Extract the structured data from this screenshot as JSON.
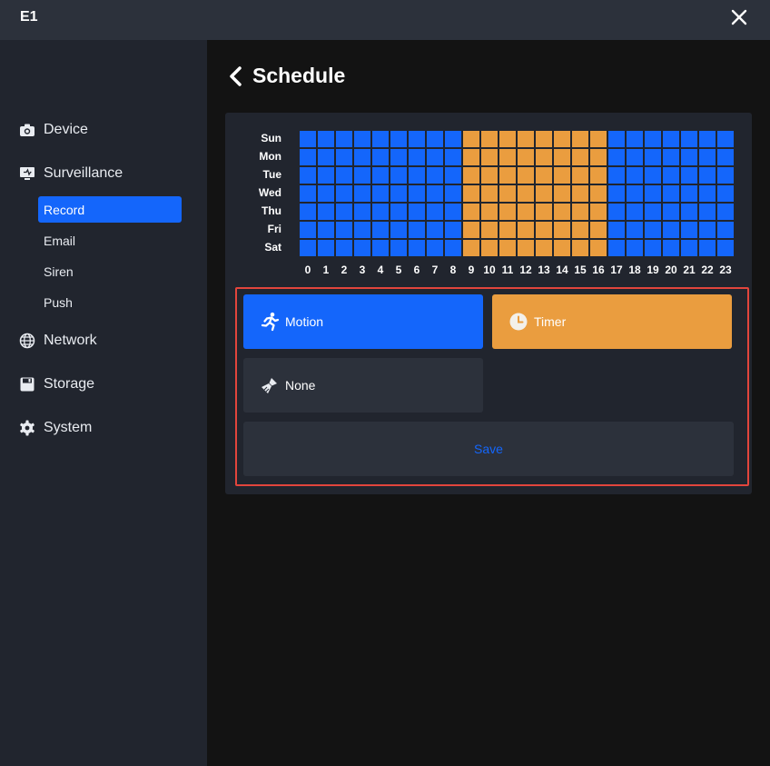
{
  "app": {
    "title": "E1"
  },
  "sidebar": {
    "items": [
      {
        "label": "Device",
        "icon": "camera-icon"
      },
      {
        "label": "Surveillance",
        "icon": "monitor-icon"
      },
      {
        "label": "Network",
        "icon": "globe-icon"
      },
      {
        "label": "Storage",
        "icon": "floppy-icon"
      },
      {
        "label": "System",
        "icon": "gear-icon"
      }
    ],
    "subitems": [
      {
        "label": "Record",
        "active": true
      },
      {
        "label": "Email",
        "active": false
      },
      {
        "label": "Siren",
        "active": false
      },
      {
        "label": "Push",
        "active": false
      }
    ]
  },
  "page": {
    "title": "Schedule"
  },
  "schedule": {
    "days": [
      "Sun",
      "Mon",
      "Tue",
      "Wed",
      "Thu",
      "Fri",
      "Sat"
    ],
    "hours": [
      "0",
      "1",
      "2",
      "3",
      "4",
      "5",
      "6",
      "7",
      "8",
      "9",
      "10",
      "11",
      "12",
      "13",
      "14",
      "15",
      "16",
      "17",
      "18",
      "19",
      "20",
      "21",
      "22",
      "23"
    ],
    "grid": [
      "MMMMMMMMMTTTTTTTTMMMMMMM",
      "MMMMMMMMMTTTTTTTTMMMMMMM",
      "MMMMMMMMMTTTTTTTTMMMMMMM",
      "MMMMMMMMMTTTTTTTTMMMMMMM",
      "MMMMMMMMMTTTTTTTTMMMMMMM",
      "MMMMMMMMMTTTTTTTTMMMMMMM",
      "MMMMMMMMMTTTTTTTTMMMMMMM"
    ],
    "legend": {
      "M": "Motion",
      "T": "Timer",
      "N": "None"
    }
  },
  "modes": {
    "motion_label": "Motion",
    "timer_label": "Timer",
    "none_label": "None",
    "save_label": "Save"
  },
  "colors": {
    "motion": "#1466fb",
    "timer": "#ea9d3f",
    "accent": "#1466fb",
    "highlight_border": "#e2453c"
  }
}
